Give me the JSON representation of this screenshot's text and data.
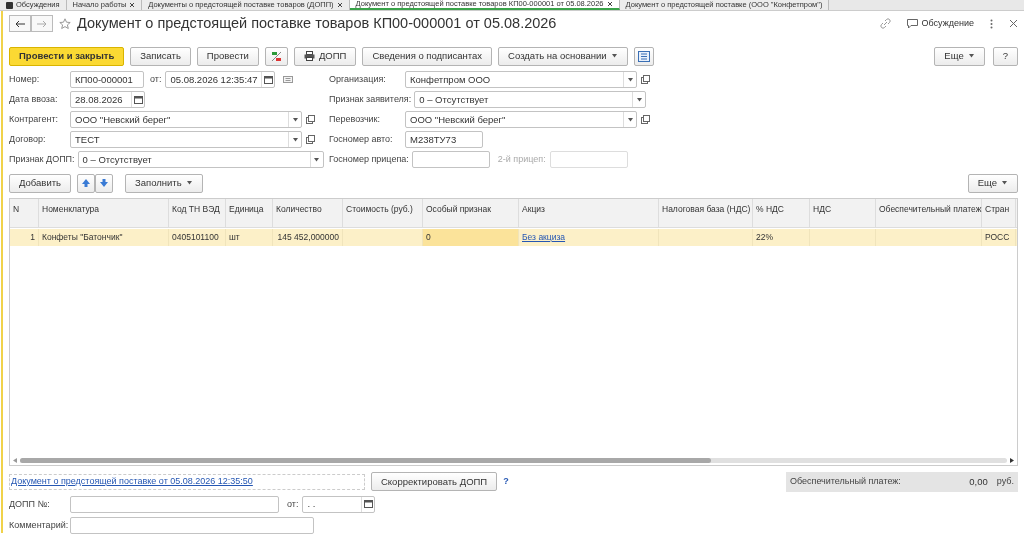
{
  "tabs": [
    {
      "label": "Обсуждения",
      "selected": false,
      "closable": false
    },
    {
      "label": "Начало работы",
      "selected": false,
      "closable": true
    },
    {
      "label": "Документы о предстоящей поставке товаров (ДОПП)",
      "selected": false,
      "closable": true
    },
    {
      "label": "Документ о предстоящей поставке товаров КП00-000001 от 05.08.2026",
      "selected": true,
      "closable": true
    },
    {
      "label": "Документ о предстоящей поставке (ООО \"Конфетпром\")",
      "selected": false,
      "closable": false
    }
  ],
  "window": {
    "title": "Документ о предстоящей поставке товаров КП00-000001 от 05.08.2026",
    "discussion": "Обсуждение"
  },
  "toolbar": {
    "buttons": [
      {
        "kind": "primary",
        "label": "Провести и закрыть"
      },
      {
        "kind": "plain",
        "label": "Записать"
      },
      {
        "kind": "plain",
        "label": "Провести"
      },
      {
        "kind": "ledger"
      },
      {
        "kind": "print",
        "label": "ДОПП"
      },
      {
        "kind": "plain",
        "label": "Сведения о подписантах"
      },
      {
        "kind": "dropdown",
        "label": "Создать на основании"
      },
      {
        "kind": "structure"
      }
    ],
    "more": "Еще",
    "help": "?"
  },
  "form": {
    "rows": [
      {
        "left": [
          {
            "label": "Номер:",
            "value": "КП00-000001",
            "kind": "text"
          },
          {
            "label": "от:",
            "value": "05.08.2026 12:35:47",
            "kind": "date",
            "note": true
          }
        ],
        "right": [
          {
            "label": "Организация:",
            "value": "Конфетпром ООО",
            "kind": "select_open"
          }
        ]
      },
      {
        "left": [
          {
            "label": "Дата ввоза:",
            "value": "28.08.2026",
            "kind": "date",
            "note": false
          }
        ],
        "right": [
          {
            "label": "Признак заявителя:",
            "value": "0 – Отсутствует",
            "kind": "select"
          }
        ]
      },
      {
        "left": [
          {
            "label": "Контрагент:",
            "value": "ООО \"Невский берег\"",
            "kind": "select_open"
          }
        ],
        "right": [
          {
            "label": "Перевозчик:",
            "value": "ООО \"Невский берег\"",
            "kind": "select_open"
          }
        ]
      },
      {
        "left": [
          {
            "label": "Договор:",
            "value": "ТЕСТ",
            "kind": "select_open"
          }
        ],
        "right": [
          {
            "label": "Госномер авто:",
            "value": "М238ТУ73",
            "kind": "text"
          }
        ]
      },
      {
        "left": [
          {
            "label": "Признак ДОПП:",
            "value": "0 – Отсутствует",
            "kind": "select"
          }
        ],
        "right": [
          {
            "label": "Госномер прицепа:",
            "kind": "text"
          },
          {
            "label": "2-й прицеп:",
            "kind": "text",
            "disabled": true
          }
        ]
      }
    ]
  },
  "table_toolbar": {
    "add": "Добавить",
    "fill": "Заполнить",
    "more": "Еще"
  },
  "table": {
    "columns": [
      "N",
      "Номенклатура",
      "Код ТН ВЭД",
      "Единица",
      "Количество",
      "Стоимость (руб.)",
      "Особый признак",
      "Акциз",
      "Налоговая база (НДС)",
      "% НДС",
      "НДС",
      "Обеспечительный платеж",
      "Стран"
    ],
    "rows": [
      {
        "selected": true,
        "cells": [
          "1",
          "Конфеты \"Батончик\"",
          "0405101100",
          "шт",
          "145 452,000000",
          "",
          "0",
          "Без акциза",
          "",
          "22%",
          "",
          "",
          "РОСС"
        ]
      }
    ]
  },
  "footer": {
    "link": "Документ о предстоящей поставке от 05.08.2026 12:35:50",
    "correct_button": "Скорректировать ДОПП",
    "help": "?",
    "deposit_label": "Обеспечительный платеж:",
    "deposit_value": "0,00",
    "currency": "руб.",
    "dopp_label": "ДОПП №:",
    "from_label": "от:",
    "from_value": ". .",
    "comment_label": "Комментарий:"
  }
}
